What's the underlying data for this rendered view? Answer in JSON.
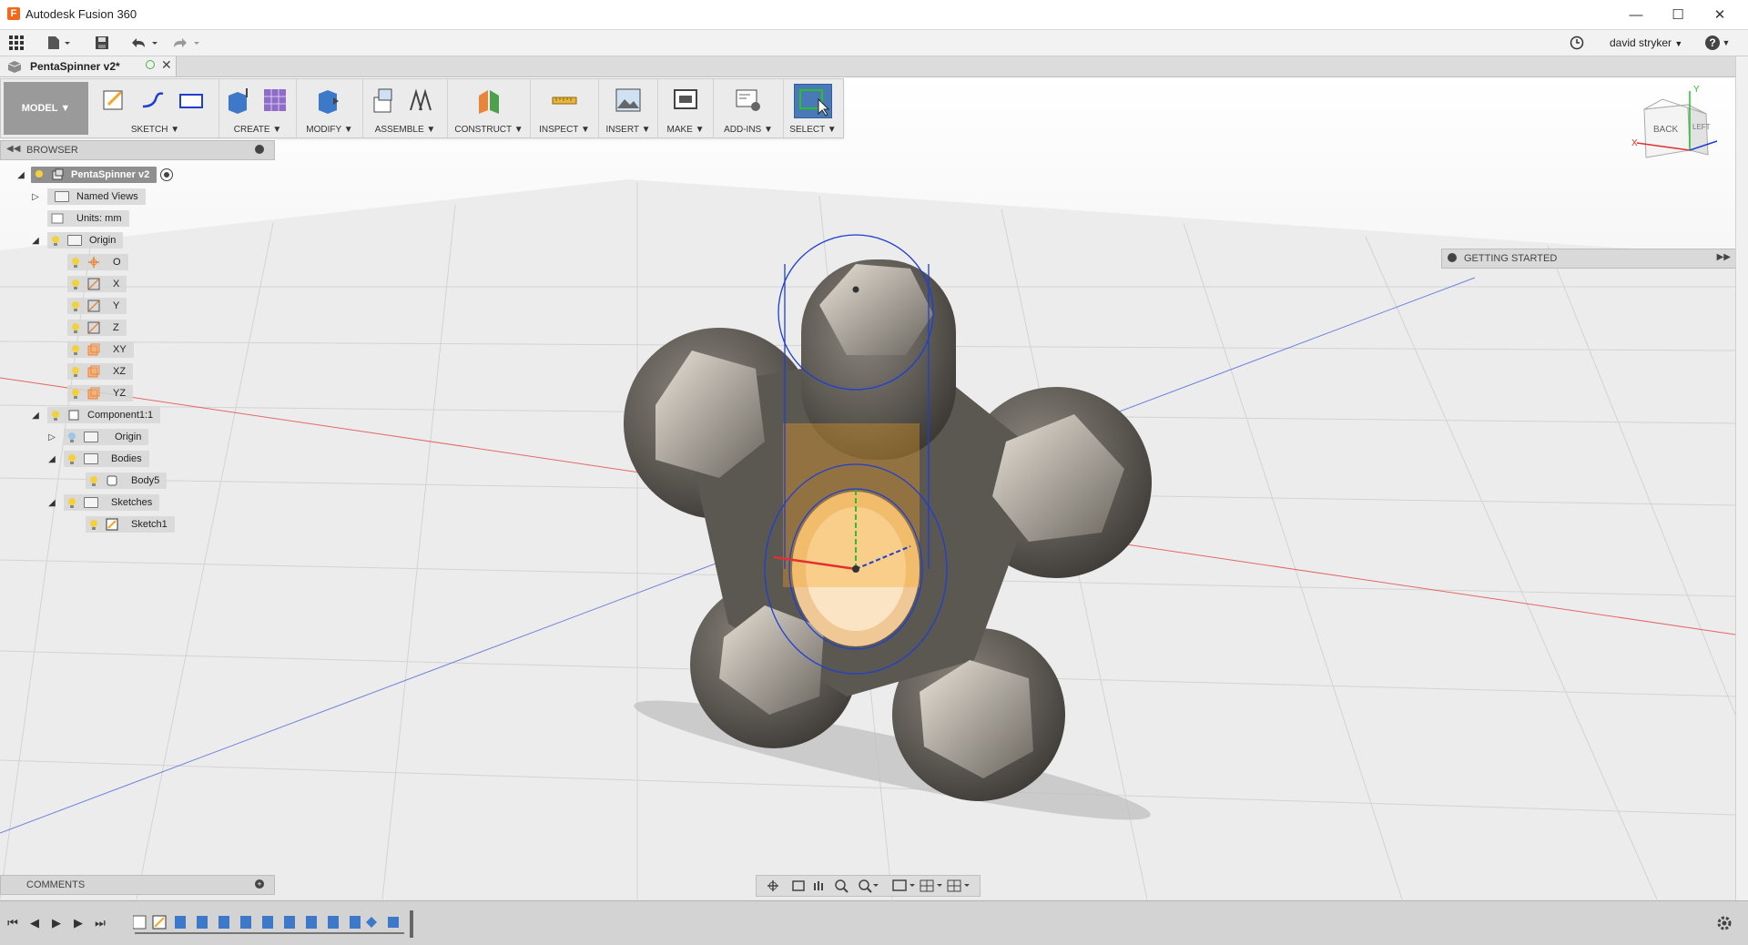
{
  "window": {
    "title": "Autodesk Fusion 360",
    "app_icon_letter": "F"
  },
  "quick_access": {
    "user_name": "david stryker",
    "user_arrow": "▼",
    "help_arrow": "▼"
  },
  "document_tab": {
    "name": "PentaSpinner v2*"
  },
  "toolbar": {
    "workspace": "MODEL ▼",
    "groups": [
      {
        "label": "SKETCH ▼"
      },
      {
        "label": "CREATE ▼"
      },
      {
        "label": "MODIFY ▼"
      },
      {
        "label": "ASSEMBLE ▼"
      },
      {
        "label": "CONSTRUCT ▼"
      },
      {
        "label": "INSPECT ▼"
      },
      {
        "label": "INSERT ▼"
      },
      {
        "label": "MAKE ▼"
      },
      {
        "label": "ADD-INS ▼"
      },
      {
        "label": "SELECT ▼"
      }
    ]
  },
  "browser": {
    "title": "BROWSER",
    "root": "PentaSpinner v2",
    "items": [
      {
        "label": "Named Views"
      },
      {
        "label": "Units: mm"
      },
      {
        "label": "Origin"
      },
      {
        "label": "O"
      },
      {
        "label": "X"
      },
      {
        "label": "Y"
      },
      {
        "label": "Z"
      },
      {
        "label": "XY"
      },
      {
        "label": "XZ"
      },
      {
        "label": "YZ"
      },
      {
        "label": "Component1:1"
      },
      {
        "label": "Origin"
      },
      {
        "label": "Bodies"
      },
      {
        "label": "Body5"
      },
      {
        "label": "Sketches"
      },
      {
        "label": "Sketch1"
      }
    ]
  },
  "viewcube": {
    "face_front": "BACK",
    "face_side": "LEFT",
    "axis_x": "X",
    "axis_y": "Y"
  },
  "getting_started": {
    "label": "GETTING STARTED"
  },
  "comments": {
    "label": "COMMENTS"
  },
  "colors": {
    "accent_orange": "#f5a623",
    "sketch_blue": "#1f3fd1",
    "axis_red": "#e03030",
    "axis_green": "#2bbf2b",
    "body_gray": "#5e5a54"
  }
}
